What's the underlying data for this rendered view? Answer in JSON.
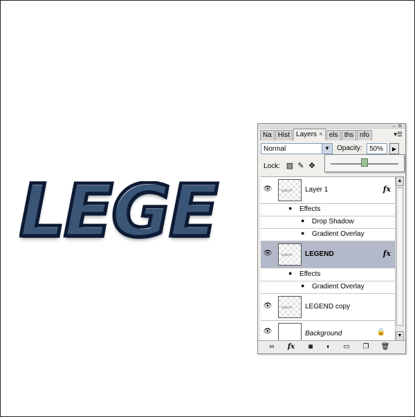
{
  "artwork": {
    "text": "LEGE"
  },
  "panel": {
    "tabs": [
      {
        "label": "Na",
        "active": false
      },
      {
        "label": "Hist",
        "active": false
      },
      {
        "label": "Layers",
        "active": true,
        "close": "×"
      },
      {
        "label": "els",
        "active": false
      },
      {
        "label": "ths",
        "active": false
      },
      {
        "label": "nfo",
        "active": false
      }
    ],
    "blend_mode": "Normal",
    "opacity_label": "Opacity:",
    "opacity_value": "50%",
    "opacity_slider_fraction": 0.5,
    "lock_label": "Lock:",
    "layers": [
      {
        "name": "Layer 1",
        "fx": "fx",
        "effects_label": "Effects",
        "effects": [
          "Drop Shadow",
          "Gradient Overlay"
        ]
      },
      {
        "name": "LEGEND",
        "fx": "fx",
        "selected": true,
        "effects_label": "Effects",
        "effects": [
          "Gradient Overlay"
        ]
      },
      {
        "name": "LEGEND copy"
      },
      {
        "name": "Background",
        "locked": true
      }
    ]
  },
  "icons": {
    "eye": "eye-icon",
    "lock": "lock-icon",
    "link": "link-icon",
    "fx": "fx-icon",
    "mask": "mask-icon",
    "adjust": "adjustment-icon",
    "folder": "folder-icon",
    "new_layer": "new-layer-icon",
    "trash": "trash-icon"
  }
}
